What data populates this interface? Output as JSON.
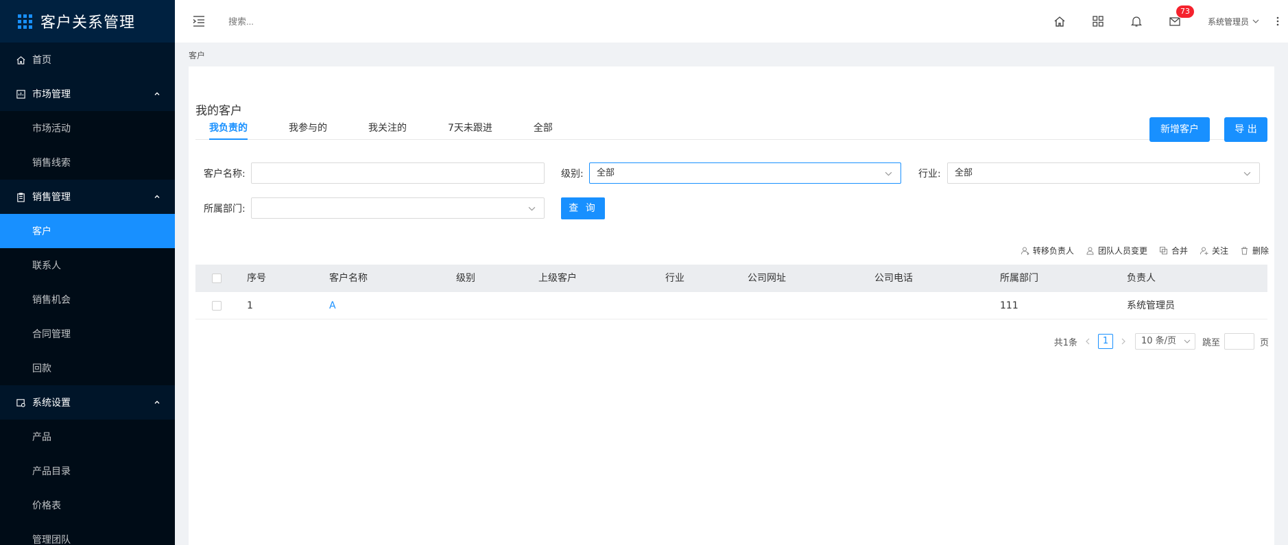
{
  "app": {
    "title": "客户关系管理"
  },
  "sidebar": {
    "items": [
      {
        "label": "首页",
        "type": "top",
        "icon": "home-icon"
      },
      {
        "label": "市场管理",
        "type": "group",
        "icon": "market-icon"
      },
      {
        "label": "市场活动",
        "type": "sub"
      },
      {
        "label": "销售线索",
        "type": "sub"
      },
      {
        "label": "销售管理",
        "type": "group",
        "icon": "clipboard-icon"
      },
      {
        "label": "客户",
        "type": "active"
      },
      {
        "label": "联系人",
        "type": "sub"
      },
      {
        "label": "销售机会",
        "type": "sub"
      },
      {
        "label": "合同管理",
        "type": "sub"
      },
      {
        "label": "回款",
        "type": "sub"
      },
      {
        "label": "系统设置",
        "type": "group",
        "icon": "settings-icon"
      },
      {
        "label": "产品",
        "type": "sub"
      },
      {
        "label": "产品目录",
        "type": "sub"
      },
      {
        "label": "价格表",
        "type": "sub"
      },
      {
        "label": "管理团队",
        "type": "sub"
      }
    ]
  },
  "header": {
    "search_placeholder": "搜索...",
    "notification_count": "73",
    "user_name": "系统管理员"
  },
  "breadcrumb": "客户",
  "page": {
    "title": "我的客户",
    "tabs": [
      "我负责的",
      "我参与的",
      "我关注的",
      "7天未跟进",
      "全部"
    ],
    "active_tab": 0,
    "new_button": "新增客户",
    "export_button": "导 出"
  },
  "filters": {
    "name_label": "客户名称:",
    "name_value": "",
    "level_label": "级别:",
    "level_value": "全部",
    "industry_label": "行业:",
    "industry_value": "全部",
    "dept_label": "所属部门:",
    "dept_value": "",
    "query_button": "查 询"
  },
  "actions": [
    "转移负责人",
    "团队人员变更",
    "合并",
    "关注",
    "删除"
  ],
  "table": {
    "columns": [
      "序号",
      "客户名称",
      "级别",
      "上级客户",
      "行业",
      "公司网址",
      "公司电话",
      "所属部门",
      "负责人"
    ],
    "rows": [
      {
        "no": "1",
        "name": "A",
        "level": "",
        "parent": "",
        "industry": "",
        "website": "",
        "phone": "",
        "dept": "111",
        "owner": "系统管理员"
      }
    ]
  },
  "pagination": {
    "total": "共1条",
    "current": "1",
    "page_size": "10 条/页",
    "goto_label": "跳至",
    "page_suffix": "页"
  },
  "colors": {
    "accent": "#1890ff",
    "sidebar": "#001529",
    "badge": "#f5222d"
  }
}
